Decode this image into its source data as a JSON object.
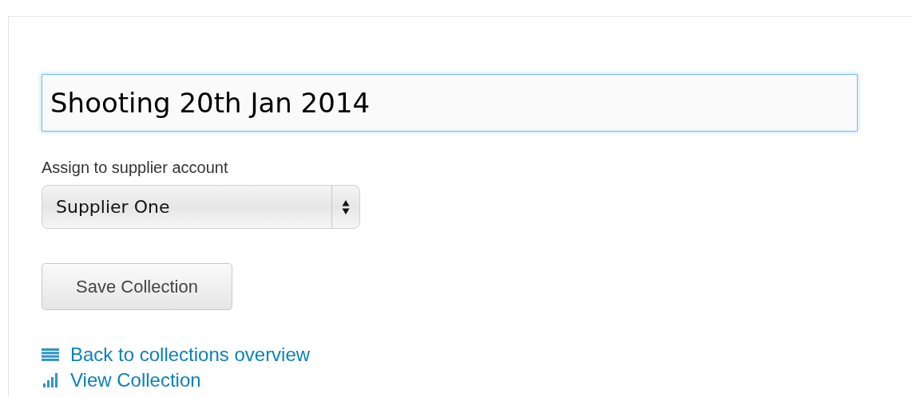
{
  "title_field": {
    "value": "Shooting 20th Jan 2014"
  },
  "supplier": {
    "label": "Assign to supplier account",
    "value": "Supplier One"
  },
  "save_button": "Save Collection",
  "links": [
    {
      "kind": "list",
      "label": "Back to collections overview"
    },
    {
      "kind": "bars",
      "label": "View Collection"
    }
  ]
}
